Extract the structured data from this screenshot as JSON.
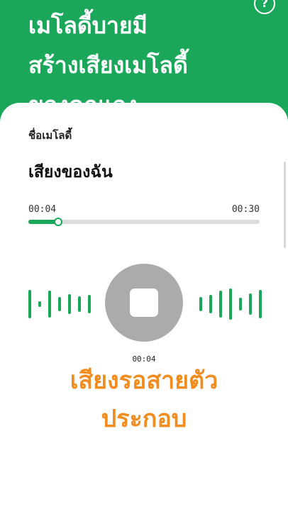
{
  "header": {
    "title": "เมโลดี้บายมี\nสร้างเสียงเมโลดี้\nของคุณเอง",
    "help_icon": "help-circle-icon"
  },
  "melody": {
    "name_label": "ชื่อเมโลดี้",
    "name": "เสียงของฉัน"
  },
  "player": {
    "elapsed": "00:04",
    "total": "00:30",
    "progress": 0.13,
    "stop_icon": "stop-icon",
    "recording_time": "00:04"
  },
  "caption": "เสียงรอสายตัว\nประกอบ",
  "colors": {
    "accent": "#1aa75a",
    "caption": "#f28c1e",
    "stop_button": "#ababab"
  }
}
